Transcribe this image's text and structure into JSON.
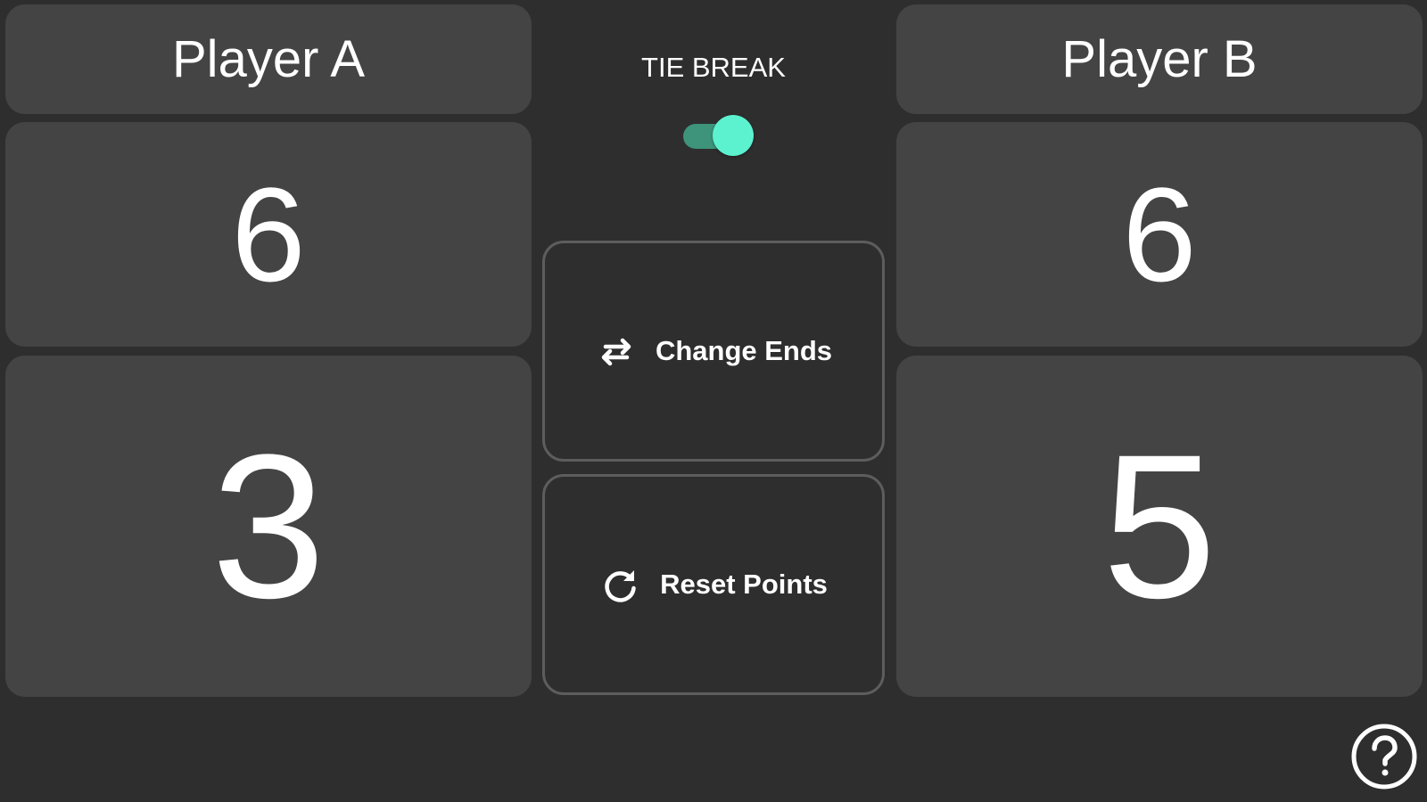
{
  "player_a": {
    "name": "Player A",
    "games": "6",
    "points": "3"
  },
  "player_b": {
    "name": "Player B",
    "games": "6",
    "points": "5"
  },
  "tie_break": {
    "label": "TIE BREAK",
    "enabled": true,
    "accent_color": "#5cf2d0"
  },
  "actions": {
    "change_ends": {
      "label": "Change Ends",
      "icon": "swap-arrows-icon"
    },
    "reset_points": {
      "label": "Reset Points",
      "icon": "refresh-icon"
    }
  },
  "help": {
    "icon": "help-icon"
  },
  "colors": {
    "background": "#2e2e2e",
    "panel": "#444444",
    "button_border": "#5d5d5d",
    "text": "#ffffff"
  }
}
